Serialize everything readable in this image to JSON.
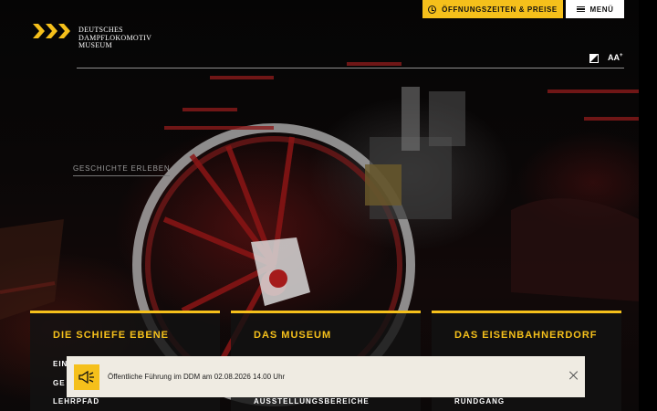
{
  "header": {
    "logo_line1": "DEUTSCHES",
    "logo_line2": "DAMPFLOKOMOTIV",
    "logo_line3": "MUSEUM",
    "hours_button": "ÖFFNUNGSZEITEN & PREISE",
    "menu_button": "MENÜ",
    "font_size_label": "AA",
    "font_size_sup": "+"
  },
  "hero": {
    "link_label": "GESCHICHTE ERLEBEN"
  },
  "cards": [
    {
      "title": "DIE SCHIEFE EBENE",
      "links": [
        "EIN",
        "GE",
        "LEHRPFAD"
      ]
    },
    {
      "title": "DAS MUSEUM",
      "links": [
        "AUSSTELLUNGSBEREICHE"
      ]
    },
    {
      "title": "DAS EISENBAHNERDORF",
      "links": [
        "RUNDGANG"
      ]
    }
  ],
  "notice": {
    "text": "Öffentliche Führung im DDM am 02.08.2026 14.00 Uhr"
  },
  "colors": {
    "accent": "#f5c01b",
    "banner_bg": "#efebe2",
    "background": "#000000"
  },
  "icons": [
    "logo-chevrons-icon",
    "clock-icon",
    "hamburger-icon",
    "contrast-icon",
    "font-size-icon",
    "megaphone-icon",
    "close-icon"
  ]
}
